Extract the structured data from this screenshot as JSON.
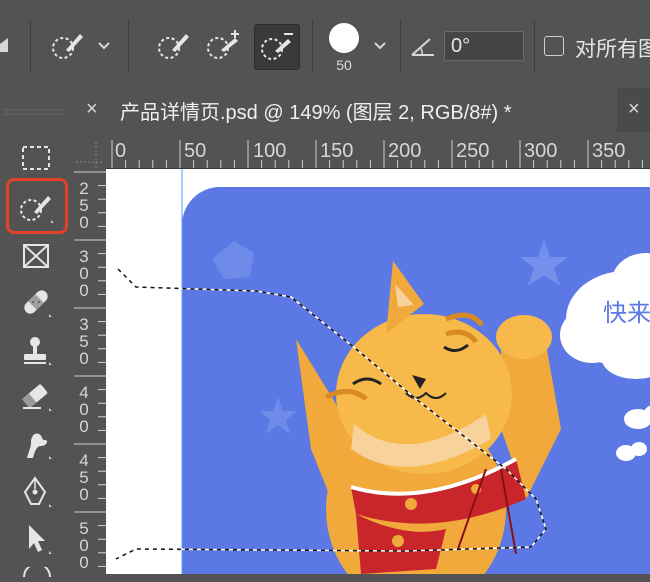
{
  "options_bar": {
    "brush_size": "50",
    "angle": "0°",
    "sample_all_layers_label": "对所有图"
  },
  "tab": {
    "title": "产品详情页.psd @ 149% (图层 2, RGB/8#) *",
    "close_glyph": "×"
  },
  "ruler": {
    "h_labels": [
      "0",
      "50",
      "100",
      "150",
      "200",
      "250",
      "300",
      "350"
    ],
    "v_labels": [
      [
        "2",
        "5",
        "0"
      ],
      [
        "3",
        "0",
        "0"
      ],
      [
        "3",
        "5",
        "0"
      ],
      [
        "4",
        "0",
        "0"
      ],
      [
        "4",
        "5",
        "0"
      ],
      [
        "5",
        "0",
        "0"
      ]
    ]
  },
  "canvas": {
    "bubble_text": "快来"
  },
  "colors": {
    "ui_bg": "#535353",
    "card_blue": "#5b78e4",
    "highlight_red": "#e0422a",
    "cat_orange": "#f0a93a",
    "bow_red": "#c8262a"
  },
  "icons": {
    "tools": [
      "marquee-icon",
      "quick-selection-icon",
      "frame-icon",
      "healing-brush-icon",
      "clone-stamp-icon",
      "eraser-icon",
      "smudge-icon",
      "pen-icon",
      "move-arrow-icon"
    ]
  }
}
